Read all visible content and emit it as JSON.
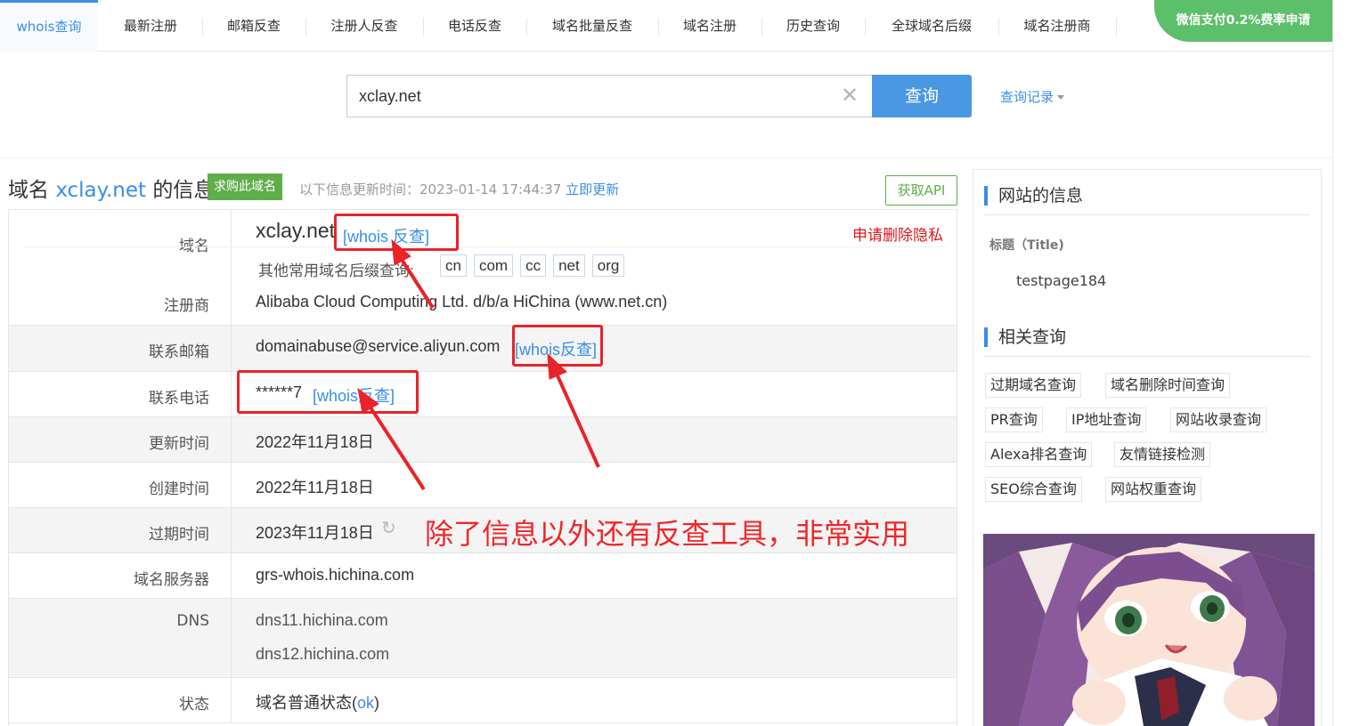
{
  "nav": {
    "items": [
      {
        "label": "whois查询",
        "active": true
      },
      {
        "label": "最新注册"
      },
      {
        "label": "邮箱反查"
      },
      {
        "label": "注册人反查"
      },
      {
        "label": "电话反查"
      },
      {
        "label": "域名批量反查"
      },
      {
        "label": "域名注册"
      },
      {
        "label": "历史查询"
      },
      {
        "label": "全球域名后缀"
      },
      {
        "label": "域名注册商"
      }
    ],
    "promo": "微信支付0.2%费率申请"
  },
  "search": {
    "value": "xclay.net",
    "clear_icon": "close-icon",
    "button": "查询",
    "history": "查询记录"
  },
  "header": {
    "title_prefix": "域名",
    "title_domain": "xclay.net",
    "title_suffix": "的信息",
    "buy_badge": "求购此域名",
    "update_label": "以下信息更新时间：2023-01-14 17:44:37",
    "update_link": "立即更新",
    "api_button": "获取API"
  },
  "table": {
    "domain_label": "域名",
    "domain_value": "xclay.net",
    "domain_reverse": "[whois 反查]",
    "privacy_link": "申请删除隐私",
    "other_tld_label": "其他常用域名后缀查询:",
    "tlds": [
      "cn",
      "com",
      "cc",
      "net",
      "org"
    ],
    "registrar_label": "注册商",
    "registrar_value": "Alibaba Cloud Computing Ltd. d/b/a HiChina (www.net.cn)",
    "email_label": "联系邮箱",
    "email_value": "domainabuse@service.aliyun.com",
    "email_reverse": "[whois反查]",
    "phone_label": "联系电话",
    "phone_value": "******7",
    "phone_reverse": "[whois反查]",
    "updated_label": "更新时间",
    "updated_value": "2022年11月18日",
    "created_label": "创建时间",
    "created_value": "2022年11月18日",
    "expires_label": "过期时间",
    "expires_value": "2023年11月18日",
    "ns_label": "域名服务器",
    "ns_value": "grs-whois.hichina.com",
    "dns_label": "DNS",
    "dns_values": [
      "dns11.hichina.com",
      "dns12.hichina.com"
    ],
    "status_label": "状态",
    "status_prefix": "域名普通状态(",
    "status_code": "ok",
    "status_suffix": ")"
  },
  "annotation": {
    "text": "除了信息以外还有反查工具，非常实用",
    "color": "#f0262b"
  },
  "sidebar": {
    "site_info_heading": "网站的信息",
    "title_label": "标题（Title)",
    "title_value": "testpage184",
    "related_heading": "相关查询",
    "tags": [
      "过期域名查询",
      "域名删除时间查询",
      "PR查询",
      "IP地址查询",
      "网站收录查询",
      "Alexa排名查询",
      "友情链接检测",
      "SEO综合查询",
      "网站权重查询"
    ]
  },
  "colors": {
    "accent": "#3a8ee6",
    "green": "#5fae4a",
    "annotation_red": "#e8232a"
  }
}
